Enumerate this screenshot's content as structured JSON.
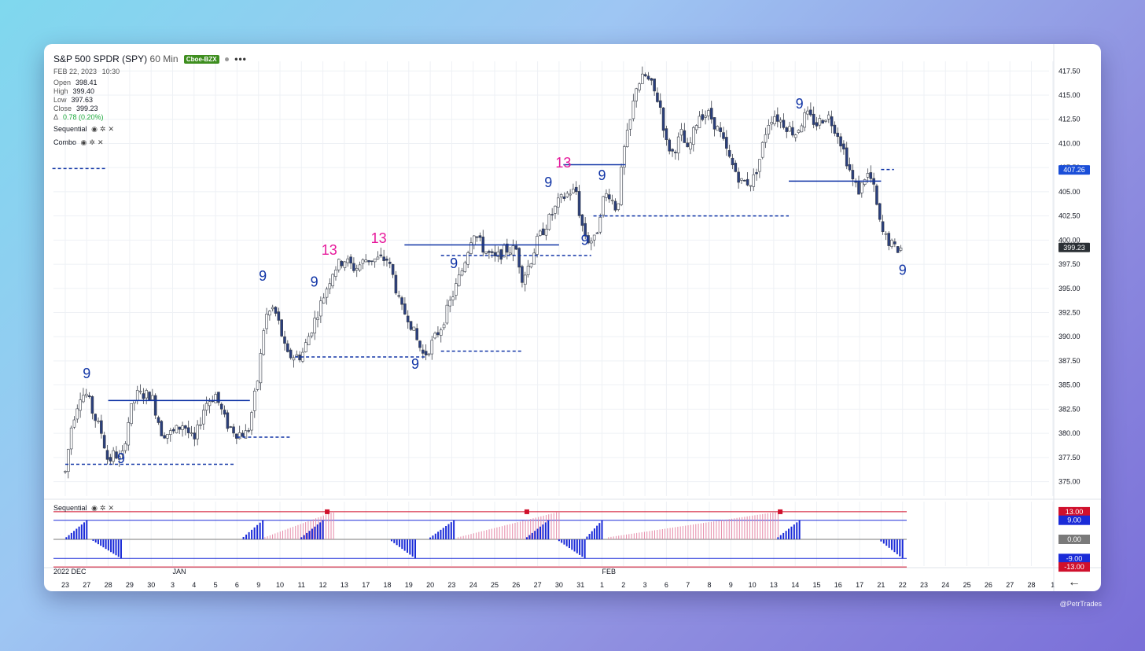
{
  "header": {
    "symbol_title": "S&P 500 SPDR (SPY)",
    "interval": "60 Min",
    "exchange_badge": "Cboe-BZX",
    "date": "FEB 22, 2023",
    "time": "10:30"
  },
  "ohlc": {
    "open_label": "Open",
    "open": "398.41",
    "high_label": "High",
    "high": "399.40",
    "low_label": "Low",
    "low": "397.63",
    "close_label": "Close",
    "close": "399.23",
    "change_label": "Δ",
    "change": "0.78 (0.20%)"
  },
  "indicators": {
    "sequential_label": "Sequential",
    "combo_label": "Combo",
    "lower_panel_label": "Sequential"
  },
  "colors": {
    "blue": "#1034a6",
    "magenta": "#e6199b",
    "red": "#d0102c",
    "grid": "#eef1f5",
    "candle_up": "#ffffff",
    "candle_down": "#2a3f7e"
  },
  "watermark": "@PetrTrades",
  "chart_data": {
    "type": "candlestick",
    "title": "S&P 500 SPDR (SPY) 60 Min",
    "y_range": [
      373.5,
      418.5
    ],
    "y_ticks": [
      "417.50",
      "415.00",
      "412.50",
      "410.00",
      "407.50",
      "405.00",
      "402.50",
      "400.00",
      "397.50",
      "395.00",
      "392.50",
      "390.00",
      "387.50",
      "385.00",
      "382.50",
      "380.00",
      "377.50",
      "375.00"
    ],
    "price_badges": [
      {
        "value": 407.26,
        "label": "407.26",
        "color": "#1a4ed8"
      },
      {
        "value": 399.23,
        "label": "399.23",
        "color": "#2b3035"
      }
    ],
    "month_labels": [
      {
        "label": "2022 DEC",
        "day_index": 0
      },
      {
        "label": "JAN",
        "day_index": 5
      },
      {
        "label": "FEB",
        "day_index": 25
      }
    ],
    "x_labels": [
      "23",
      "27",
      "28",
      "29",
      "30",
      "3",
      "4",
      "5",
      "6",
      "9",
      "10",
      "11",
      "12",
      "13",
      "17",
      "18",
      "19",
      "20",
      "23",
      "24",
      "25",
      "26",
      "27",
      "30",
      "31",
      "1",
      "2",
      "3",
      "6",
      "7",
      "8",
      "9",
      "10",
      "13",
      "14",
      "15",
      "16",
      "17",
      "21",
      "22",
      "23",
      "24",
      "25",
      "26",
      "27",
      "28",
      "1"
    ],
    "series": {
      "path_points": [
        [
          0,
          376
        ],
        [
          0.3,
          381
        ],
        [
          0.7,
          384
        ],
        [
          1,
          384
        ],
        [
          1.3,
          382
        ],
        [
          1.7,
          380
        ],
        [
          2,
          377
        ],
        [
          2.3,
          378
        ],
        [
          2.6,
          377
        ],
        [
          3,
          382
        ],
        [
          3.3,
          384
        ],
        [
          3.7,
          384
        ],
        [
          4,
          384
        ],
        [
          4.5,
          380
        ],
        [
          5,
          380
        ],
        [
          5.5,
          381
        ],
        [
          6,
          379
        ],
        [
          6.5,
          383
        ],
        [
          7,
          384
        ],
        [
          7.5,
          381
        ],
        [
          8,
          380
        ],
        [
          8.5,
          380
        ],
        [
          9,
          386
        ],
        [
          9.3,
          392
        ],
        [
          9.7,
          393
        ],
        [
          10,
          391
        ],
        [
          10.3,
          388
        ],
        [
          10.7,
          388
        ],
        [
          11,
          388
        ],
        [
          11.5,
          391
        ],
        [
          12,
          394
        ],
        [
          12.5,
          397
        ],
        [
          13,
          398
        ],
        [
          13.5,
          397
        ],
        [
          14,
          398
        ],
        [
          14.5,
          398
        ],
        [
          15,
          398
        ],
        [
          15.3,
          396
        ],
        [
          15.6,
          393
        ],
        [
          16,
          392
        ],
        [
          16.3,
          390
        ],
        [
          16.7,
          388
        ],
        [
          17,
          389
        ],
        [
          17.5,
          391
        ],
        [
          18,
          394
        ],
        [
          18.5,
          397
        ],
        [
          19,
          401
        ],
        [
          19.5,
          399
        ],
        [
          20,
          398
        ],
        [
          20.5,
          399
        ],
        [
          21,
          399
        ],
        [
          21.3,
          396
        ],
        [
          21.7,
          398
        ],
        [
          22,
          400
        ],
        [
          22.5,
          402
        ],
        [
          23,
          404
        ],
        [
          23.5,
          405
        ],
        [
          23.8,
          405
        ],
        [
          24,
          402
        ],
        [
          24.3,
          400
        ],
        [
          24.7,
          400
        ],
        [
          25,
          404
        ],
        [
          25.3,
          405
        ],
        [
          25.7,
          403
        ],
        [
          26,
          409
        ],
        [
          26.3,
          412
        ],
        [
          26.6,
          416
        ],
        [
          27,
          417
        ],
        [
          27.3,
          416
        ],
        [
          27.7,
          414
        ],
        [
          28,
          410
        ],
        [
          28.3,
          409
        ],
        [
          28.7,
          411
        ],
        [
          29,
          409
        ],
        [
          29.5,
          413
        ],
        [
          30,
          413
        ],
        [
          30.5,
          411
        ],
        [
          31,
          408
        ],
        [
          31.5,
          406
        ],
        [
          32,
          406
        ],
        [
          32.3,
          408
        ],
        [
          32.7,
          412
        ],
        [
          33,
          413
        ],
        [
          33.5,
          412
        ],
        [
          34,
          411
        ],
        [
          34.5,
          413
        ],
        [
          35,
          412
        ],
        [
          35.5,
          413
        ],
        [
          36,
          411
        ],
        [
          36.3,
          409
        ],
        [
          36.7,
          406
        ],
        [
          37,
          405
        ],
        [
          37.3,
          407
        ],
        [
          37.6,
          406
        ],
        [
          38,
          401
        ],
        [
          38.3,
          400
        ],
        [
          38.7,
          399
        ],
        [
          39,
          399.23
        ]
      ],
      "sequential_markers": [
        {
          "text": "9",
          "day": 1.0,
          "price": 385.7,
          "color": "blue",
          "big": true
        },
        {
          "text": "9",
          "day": 2.6,
          "price": 376.9,
          "color": "blue",
          "big": true
        },
        {
          "text": "9",
          "day": 9.2,
          "price": 395.8,
          "color": "blue",
          "big": true
        },
        {
          "text": "9",
          "day": 11.6,
          "price": 395.2,
          "color": "blue",
          "big": true
        },
        {
          "text": "13",
          "day": 12.3,
          "price": 398.5,
          "color": "magenta",
          "big": true
        },
        {
          "text": "13",
          "day": 14.6,
          "price": 399.7,
          "color": "magenta",
          "big": true
        },
        {
          "text": "9",
          "day": 16.3,
          "price": 386.7,
          "color": "blue",
          "big": true
        },
        {
          "text": "9",
          "day": 18.1,
          "price": 397.1,
          "color": "blue",
          "big": true
        },
        {
          "text": "9",
          "day": 22.5,
          "price": 405.5,
          "color": "blue",
          "big": true
        },
        {
          "text": "13",
          "day": 23.2,
          "price": 407.5,
          "color": "magenta",
          "big": true
        },
        {
          "text": "9",
          "day": 24.2,
          "price": 399.5,
          "color": "blue",
          "big": true
        },
        {
          "text": "9",
          "day": 25.0,
          "price": 406.2,
          "color": "blue",
          "big": true
        },
        {
          "text": "9",
          "day": 34.2,
          "price": 413.6,
          "color": "blue",
          "big": true
        },
        {
          "text": "9",
          "day": 39.0,
          "price": 396.4,
          "color": "blue",
          "big": true
        }
      ]
    },
    "horizontal_levels": [
      {
        "price": 407.4,
        "from_day": -0.6,
        "to_day": 1.9,
        "style": "dashed"
      },
      {
        "price": 383.4,
        "from_day": 2.0,
        "to_day": 8.6,
        "style": "solid"
      },
      {
        "price": 376.8,
        "from_day": 0.0,
        "to_day": 7.9,
        "style": "dashed"
      },
      {
        "price": 379.6,
        "from_day": 8.0,
        "to_day": 10.5,
        "style": "dashed"
      },
      {
        "price": 387.9,
        "from_day": 10.7,
        "to_day": 16.8,
        "style": "dashed"
      },
      {
        "price": 399.5,
        "from_day": 15.8,
        "to_day": 23.0,
        "style": "solid"
      },
      {
        "price": 398.4,
        "from_day": 17.5,
        "to_day": 24.5,
        "style": "dashed"
      },
      {
        "price": 388.5,
        "from_day": 17.5,
        "to_day": 21.3,
        "style": "dashed"
      },
      {
        "price": 407.8,
        "from_day": 23.2,
        "to_day": 26.1,
        "style": "solid"
      },
      {
        "price": 402.5,
        "from_day": 24.6,
        "to_day": 33.7,
        "style": "dashed"
      },
      {
        "price": 406.1,
        "from_day": 33.7,
        "to_day": 38.0,
        "style": "solid"
      },
      {
        "price": 407.3,
        "from_day": 38.0,
        "to_day": 38.6,
        "style": "dashed"
      }
    ],
    "lower_panel": {
      "levels": [
        {
          "value": 13,
          "label": "13.00",
          "color": "#d0102c"
        },
        {
          "value": 9,
          "label": "9.00",
          "color": "#1a2bd8"
        },
        {
          "value": 0,
          "label": "0.00",
          "color": "#7a7a7a"
        },
        {
          "value": -9,
          "label": "-9.00",
          "color": "#1a2bd8"
        },
        {
          "value": -13,
          "label": "-13.00",
          "color": "#d0102c"
        }
      ],
      "histogram_runs": [
        {
          "start": 0.05,
          "end": 1.0,
          "type": "buy",
          "peak": 9
        },
        {
          "start": 1.3,
          "end": 2.6,
          "type": "sell",
          "peak": -9
        },
        {
          "start": 8.3,
          "end": 9.2,
          "type": "buy",
          "peak": 9
        },
        {
          "start": 9.3,
          "end": 12.5,
          "type": "countdown",
          "peak": 13
        },
        {
          "start": 11.0,
          "end": 12.0,
          "type": "buy",
          "peak": 9
        },
        {
          "start": 15.2,
          "end": 16.3,
          "type": "sell",
          "peak": -9
        },
        {
          "start": 17.0,
          "end": 18.1,
          "type": "buy",
          "peak": 9
        },
        {
          "start": 18.3,
          "end": 23.0,
          "type": "countdown",
          "peak": 13
        },
        {
          "start": 21.5,
          "end": 22.5,
          "type": "buy",
          "peak": 9
        },
        {
          "start": 23.0,
          "end": 24.2,
          "type": "sell",
          "peak": -9
        },
        {
          "start": 24.3,
          "end": 25.0,
          "type": "buy",
          "peak": 9
        },
        {
          "start": 25.3,
          "end": 33.2,
          "type": "countdown",
          "peak": 13
        },
        {
          "start": 33.2,
          "end": 34.2,
          "type": "buy",
          "peak": 9
        },
        {
          "start": 38.0,
          "end": 39.0,
          "type": "sell",
          "peak": -9
        }
      ],
      "completion_days": [
        12.2,
        21.5,
        33.3
      ]
    }
  }
}
